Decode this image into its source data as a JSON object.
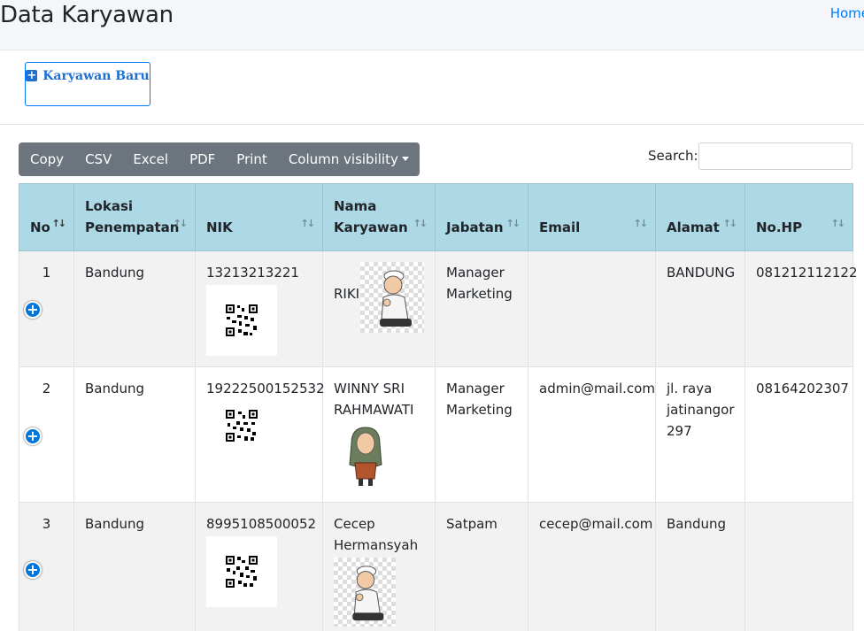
{
  "header": {
    "title": "Data Karyawan",
    "breadcrumb": "Home"
  },
  "toolbar": {
    "add_label": "Karyawan Baru",
    "export_buttons": [
      "Copy",
      "CSV",
      "Excel",
      "PDF",
      "Print",
      "Column visibility"
    ],
    "search_label": "Search:",
    "search_value": ""
  },
  "table": {
    "columns": [
      "No",
      "Lokasi Penempatan",
      "NIK",
      "Nama Karyawan",
      "Jabatan",
      "Email",
      "Alamat",
      "No.HP"
    ],
    "rows": [
      {
        "no": "1",
        "lokasi": "Bandung",
        "nik": "13213213221",
        "nama": "RIKI",
        "jabatan": "Manager Marketing",
        "email": "",
        "alamat": "BANDUNG",
        "hp": "081212112122"
      },
      {
        "no": "2",
        "lokasi": "Bandung",
        "nik": "19222500152532",
        "nama": "WINNY SRI RAHMAWATI",
        "jabatan": "Manager Marketing",
        "email": "admin@mail.com",
        "alamat": "jl. raya jatinangor 297",
        "hp": "08164202307"
      },
      {
        "no": "3",
        "lokasi": "Bandung",
        "nik": "8995108500052",
        "nama": "Cecep Hermansyah",
        "jabatan": "Satpam",
        "email": "cecep@mail.com",
        "alamat": "Bandung",
        "hp": ""
      }
    ]
  },
  "colors": {
    "accent": "#007bff",
    "header_bg": "#add8e6",
    "button_group": "#6c757d"
  },
  "icons": [
    "plus-square-icon",
    "sort-icon",
    "expand-row-icon",
    "qr-code-icon",
    "avatar-image"
  ]
}
